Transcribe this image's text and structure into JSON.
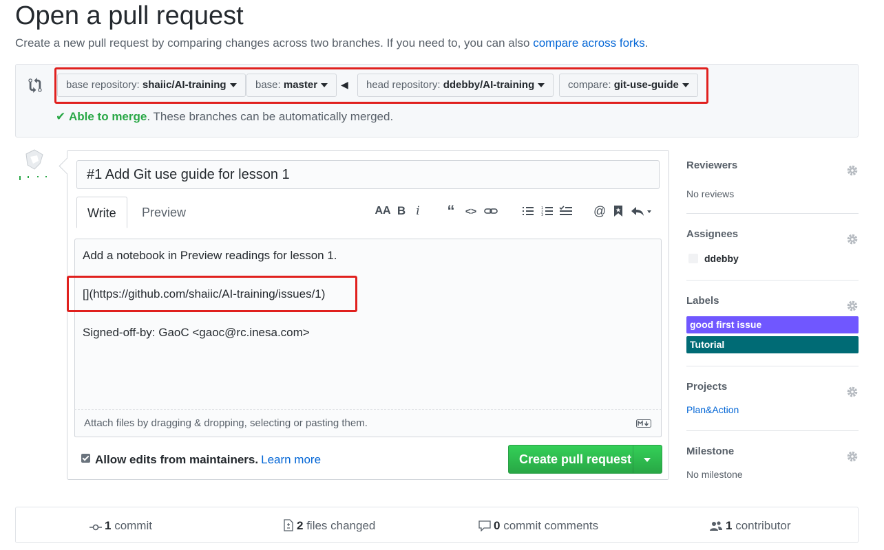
{
  "page": {
    "title": "Open a pull request",
    "subtitle_text": "Create a new pull request by comparing changes across two branches. If you need to, you can also ",
    "subtitle_link": "compare across forks",
    "subtitle_end": "."
  },
  "compare": {
    "base_repo_prefix": "base repository: ",
    "base_repo_value": "shaiic/AI-training",
    "base_prefix": "base: ",
    "base_value": "master",
    "head_repo_prefix": "head repository: ",
    "head_repo_value": "ddebby/AI-training",
    "compare_prefix": "compare: ",
    "compare_value": "git-use-guide",
    "merge_status": "Able to merge",
    "merge_message": ". These branches can be automatically merged."
  },
  "composer": {
    "title_value": "#1 Add Git use guide for lesson 1",
    "tabs": [
      "Write",
      "Preview"
    ],
    "body_lines": [
      "Add a notebook in Preview readings for lesson 1.",
      "[](https://github.com/shaiic/AI-training/issues/1)",
      "Signed-off-by: GaoC <gaoc@rc.inesa.com>"
    ],
    "attach_hint": "Attach files by dragging & dropping, selecting or pasting them.",
    "allow_edits_label": "Allow edits from maintainers.",
    "allow_edits_checked": true,
    "learn_more": "Learn more",
    "create_button": "Create pull request"
  },
  "sidebar": {
    "reviewers": {
      "heading": "Reviewers",
      "value": "No reviews"
    },
    "assignees": {
      "heading": "Assignees",
      "value": "ddebby"
    },
    "labels": {
      "heading": "Labels",
      "items": [
        {
          "name": "good first issue",
          "color": "#7057ff"
        },
        {
          "name": "Tutorial",
          "color": "#006b75"
        }
      ]
    },
    "projects": {
      "heading": "Projects",
      "value": "Plan&Action"
    },
    "milestone": {
      "heading": "Milestone",
      "value": "No milestone"
    }
  },
  "summary": {
    "commits_count": "1",
    "commits_label": " commit",
    "files_count": "2",
    "files_label": " files changed",
    "comments_count": "0",
    "comments_label": " commit comments",
    "contributors_count": "1",
    "contributors_label": " contributor"
  },
  "colors": {
    "highlight": "#e0201e",
    "success": "#28a745",
    "link": "#0366d6"
  }
}
